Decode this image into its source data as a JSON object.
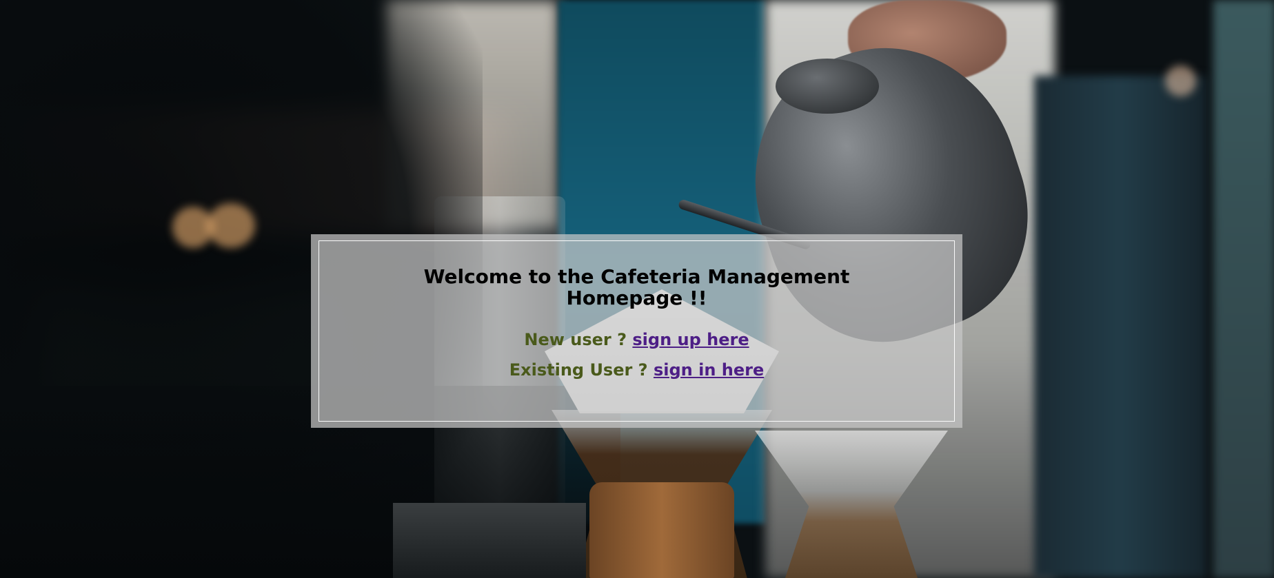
{
  "welcome": {
    "title_line1": "Welcome to the Cafeteria Management",
    "title_line2": "Homepage !!"
  },
  "new_user": {
    "prompt": "New user ?",
    "link_label": "sign up here"
  },
  "existing_user": {
    "prompt": "Existing User ?",
    "link_label": "sign in here"
  },
  "colors": {
    "prompt_text": "#4a5a1b",
    "link": "#4d1e86",
    "title": "#000000"
  }
}
